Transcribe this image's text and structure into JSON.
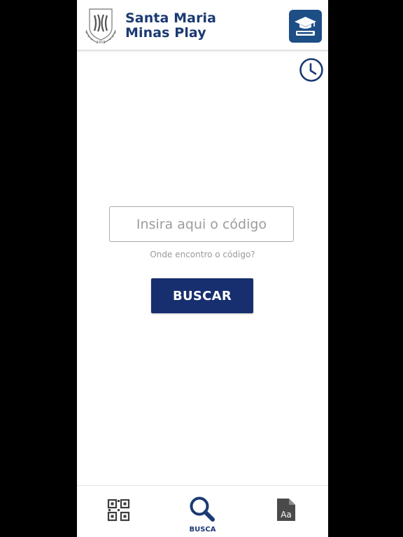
{
  "header": {
    "brand_line1": "Santa Maria",
    "brand_line2": "Minas Play",
    "logo_year": "1903",
    "logo_icon": "school-crest-logo",
    "courses_icon": "graduation-cap-book-icon",
    "history_icon": "clock-icon"
  },
  "search": {
    "placeholder": "Insira aqui o código",
    "value": "",
    "help_link": "Onde encontro o código?",
    "button_label": "BUSCAR"
  },
  "tabbar": {
    "tabs": [
      {
        "label": "",
        "icon": "qr-code-icon",
        "active": false
      },
      {
        "label": "BUSCA",
        "icon": "search-icon",
        "active": true
      },
      {
        "label": "",
        "icon": "font-document-icon",
        "active": false
      }
    ]
  },
  "colors": {
    "primary": "#1b3a73",
    "button": "#172f6e",
    "accent_tile": "#1d4e86",
    "muted_text": "#9a9a9a",
    "frame": "#000000"
  }
}
